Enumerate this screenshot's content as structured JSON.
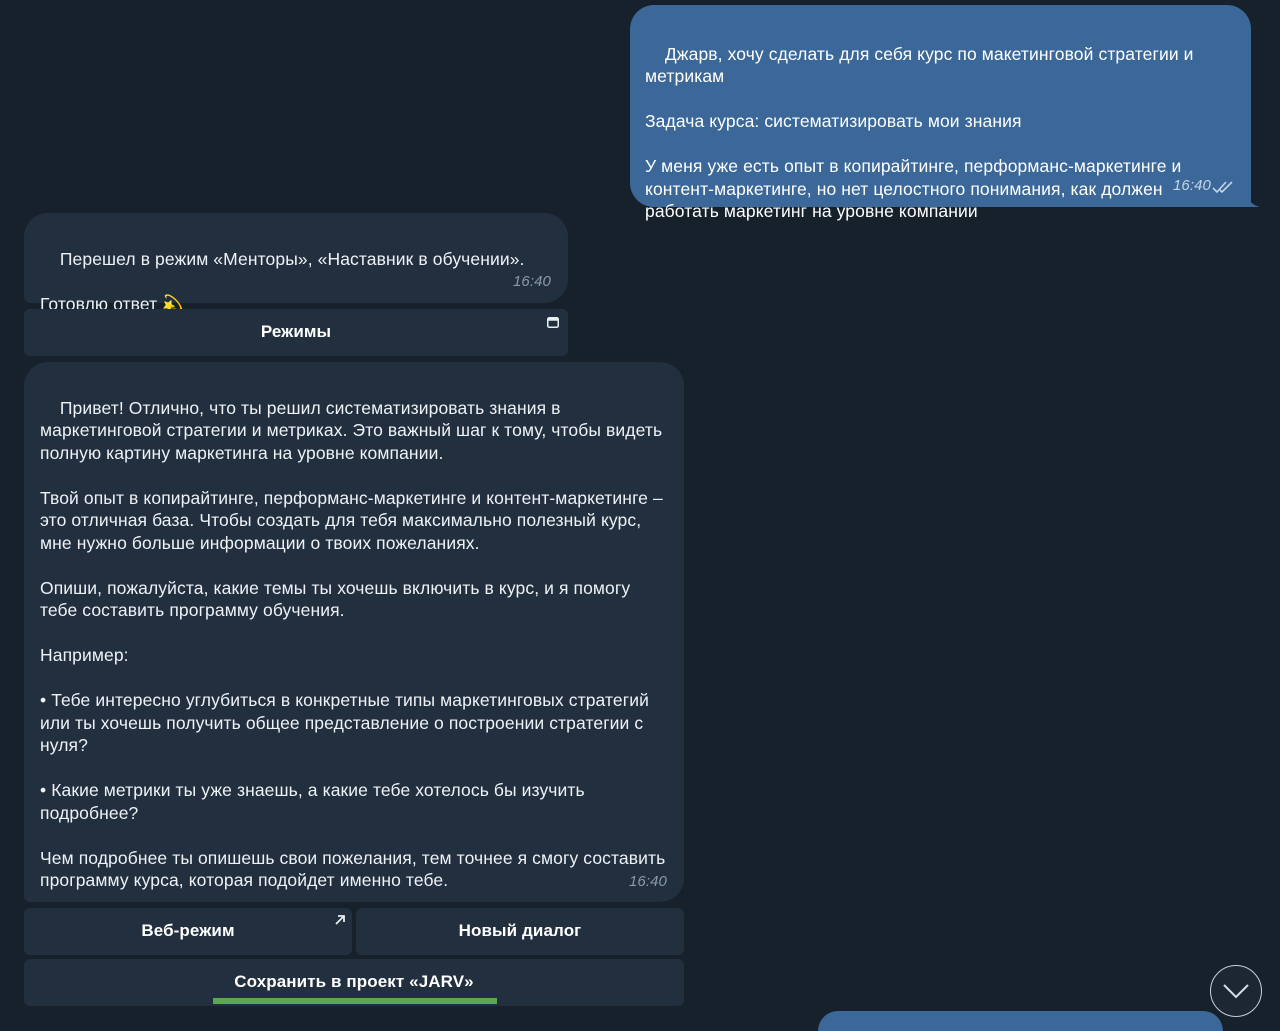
{
  "messages": {
    "outgoing": {
      "text": "Джарв, хочу сделать для себя курс по макетинговой стратегии и метрикам\n\nЗадача курса: систематизировать мои знания\n\nУ меня уже есть опыт в копирайтинге, перформанс-маркетинге и контент-маркетинге, но нет целостного понимания, как должен работать маркетинг на уровне компании",
      "time": "16:40"
    },
    "incoming_mode": {
      "text": "Перешел в режим «Менторы», «Наставник в обучении».\n\nГотовлю ответ 💫",
      "time": "16:40"
    },
    "incoming_answer": {
      "text": "Привет! Отлично, что ты решил систематизировать знания в маркетинговой стратегии и метриках. Это важный шаг к тому, чтобы видеть полную картину маркетинга на уровне компании.\n\nТвой опыт в копирайтинге, перформанс-маркетинге и контент-маркетинге – это отличная база. Чтобы создать для тебя максимально полезный курс, мне нужно больше информации о твоих пожеланиях.\n\nОпиши, пожалуйста, какие темы ты хочешь включить в курс, и я помогу тебе составить программу обучения.\n\nНапример:\n\n• Тебе интересно углубиться в конкретные типы маркетинговых стратегий или ты хочешь получить общее представление о построении стратегии с нуля?\n\n• Какие метрики ты уже знаешь, а какие тебе хотелось бы изучить подробнее?\n\nЧем подробнее ты опишешь свои пожелания, тем точнее я смогу составить программу курса, которая подойдет именно тебе.",
      "time": "16:40"
    }
  },
  "buttons": {
    "modes": "Режимы",
    "web_mode": "Веб-режим",
    "new_dialog": "Новый диалог",
    "save_project": "Сохранить в проект «JARV»"
  },
  "save_progress": 0.43,
  "icons": {
    "read_status": "double-check-icon",
    "web_app": "web-app-icon",
    "external_link": "arrow-up-right-icon",
    "scroll_down": "chevron-down-icon"
  },
  "colors": {
    "background": "#17212b",
    "outgoing_bubble": "#3b6898",
    "incoming_bubble": "#222f3f",
    "progress": "#5aa84e"
  }
}
